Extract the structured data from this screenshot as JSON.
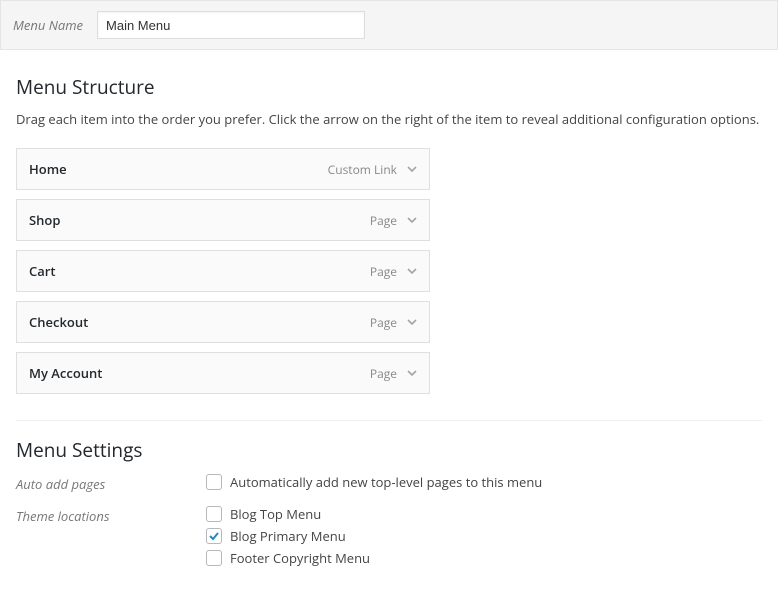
{
  "header": {
    "menu_name_label": "Menu Name",
    "menu_name_value": "Main Menu"
  },
  "structure": {
    "title": "Menu Structure",
    "instructions": "Drag each item into the order you prefer. Click the arrow on the right of the item to reveal additional configuration options.",
    "items": [
      {
        "title": "Home",
        "type": "Custom Link"
      },
      {
        "title": "Shop",
        "type": "Page"
      },
      {
        "title": "Cart",
        "type": "Page"
      },
      {
        "title": "Checkout",
        "type": "Page"
      },
      {
        "title": "My Account",
        "type": "Page"
      }
    ]
  },
  "settings": {
    "title": "Menu Settings",
    "auto_add_label": "Auto add pages",
    "auto_add_option": {
      "label": "Automatically add new top-level pages to this menu",
      "checked": false
    },
    "theme_locations_label": "Theme locations",
    "theme_locations": [
      {
        "label": "Blog Top Menu",
        "checked": false
      },
      {
        "label": "Blog Primary Menu",
        "checked": true
      },
      {
        "label": "Footer Copyright Menu",
        "checked": false
      }
    ]
  },
  "colors": {
    "check_accent": "#1e8cbe"
  }
}
